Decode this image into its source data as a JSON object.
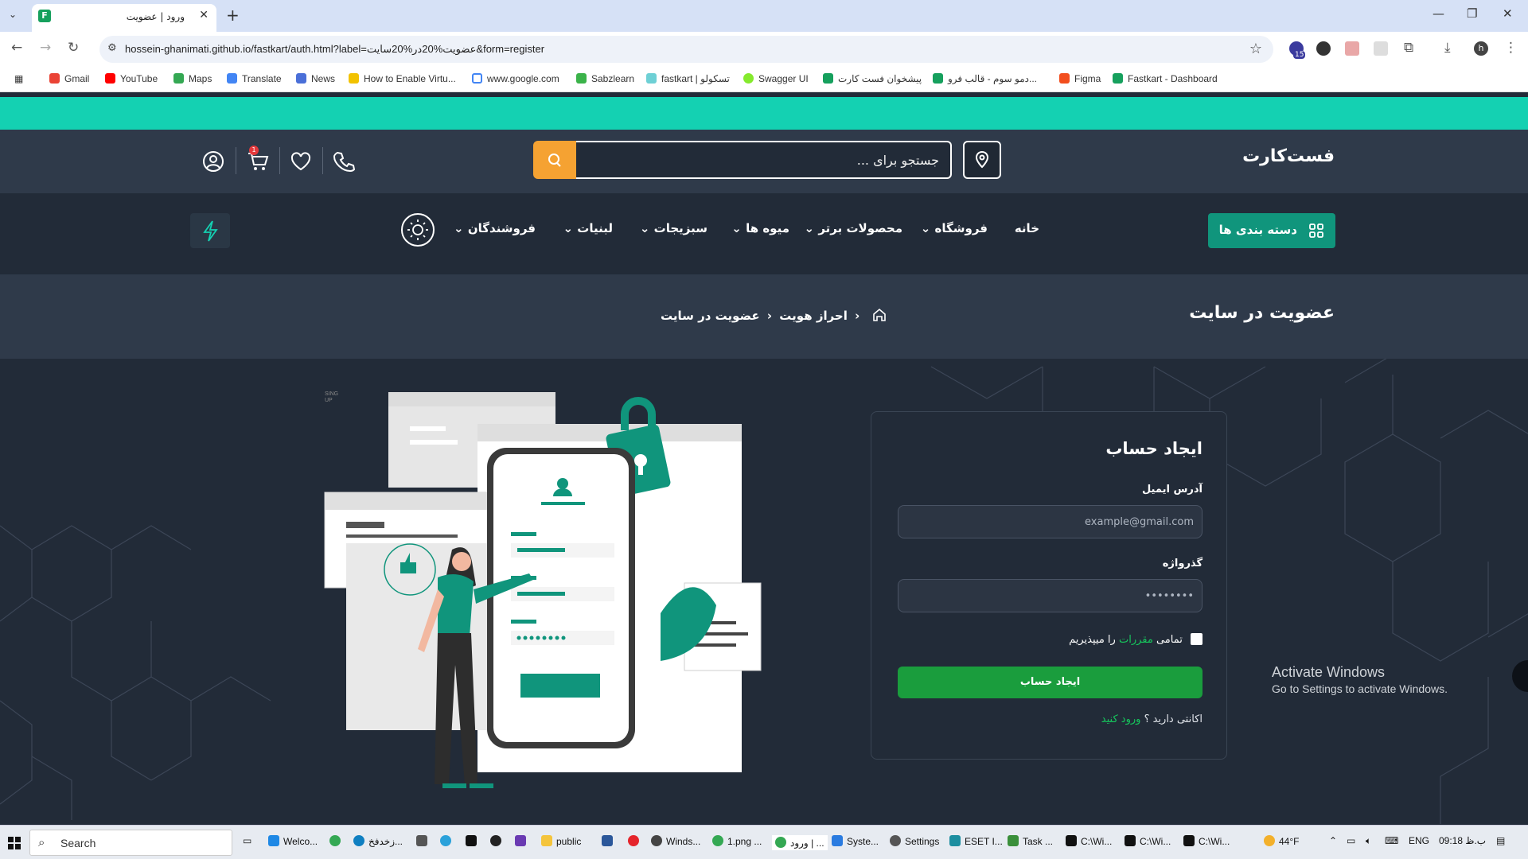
{
  "browser": {
    "tab_title": "ورود | عضویت",
    "url": "hossein-ghanimati.github.io/fastkart/auth.html?label=عضویت%20در%20سایت&form=register",
    "bookmarks": [
      "Gmail",
      "YouTube",
      "Maps",
      "Translate",
      "News",
      "How to Enable Virtu...",
      "www.google.com",
      "Sabzlearn",
      "fastkart | تسکولو",
      "Swagger UI",
      "پیشخوان فست کارت",
      "دمو سوم - قالب فرو...",
      "Figma",
      "Fastkart - Dashboard"
    ],
    "ext_badge": "15",
    "profile_initial": "h"
  },
  "header": {
    "logo": "فست‌کارت",
    "search_placeholder": "جستجو برای ...",
    "cart_count": "1",
    "categories_label": "دسته بندی ها",
    "menu": [
      "خانه",
      "فروشگاه",
      "محصولات برتر",
      "میوه ها",
      "سبزیجات",
      "لبنیات",
      "فروشندگان"
    ]
  },
  "breadcrumb": {
    "page_title": "عضویت در سایت",
    "items": [
      "احراز هویت",
      "عضویت در سایت"
    ]
  },
  "form": {
    "title": "ایجاد حساب",
    "email_label": "آدرس ایمیل",
    "email_placeholder": "example@gmail.com",
    "password_label": "گذرواژه",
    "password_placeholder": "••••••••",
    "terms_before": "تمامی",
    "terms_link": "مقررات",
    "terms_after": "را میپذیریم",
    "submit": "ایجاد حساب",
    "have_account": "اکانتی دارید ؟",
    "login_link": "ورود کنید"
  },
  "illustration": {
    "corner_text_1": "SING",
    "corner_text_2": "UP"
  },
  "watermark": {
    "line1": "Activate Windows",
    "line2": "Go to Settings to activate Windows."
  },
  "taskbar": {
    "search": "Search",
    "apps": [
      "Welco...",
      "زخدفخ...",
      "public",
      "Winds...",
      "1.png ...",
      "ورود | ...",
      "Syste...",
      "Settings",
      "ESET I...",
      "Task ...",
      "C:\\Wi...",
      "C:\\Wi...",
      "C:\\Wi..."
    ],
    "weather": "44°F",
    "lang": "ENG",
    "time": "09:18 ب.ظ"
  },
  "colors": {
    "accent": "#14d1b2",
    "primary": "#10957c",
    "submit": "#1a9d3d",
    "search_button": "#f5a232",
    "bg": "#222b38"
  }
}
